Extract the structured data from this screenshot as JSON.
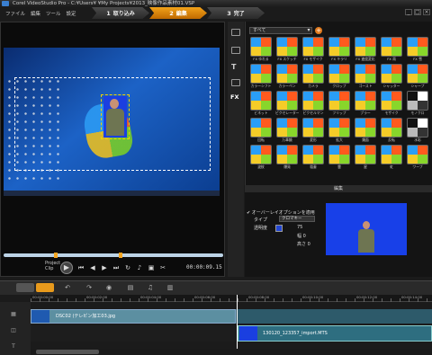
{
  "window": {
    "title": "Corel VideoStudio Pro - C:¥Users¥ ¥My Projects¥2013_映像作品素材01.VSP"
  },
  "menu": [
    "ファイル",
    "編集",
    "ツール",
    "設定"
  ],
  "steps": [
    {
      "num": "1",
      "label": "取り込み",
      "active": false
    },
    {
      "num": "2",
      "label": "編集",
      "active": true
    },
    {
      "num": "3",
      "label": "完了",
      "active": false
    }
  ],
  "window_buttons": [
    "_",
    "□",
    "×"
  ],
  "player": {
    "project_label": "Project",
    "clip_label": "Clip",
    "timecode": "00:00:09.15",
    "controls": [
      "play-icon",
      "home-icon",
      "prev-frame-icon",
      "next-frame-icon",
      "end-icon",
      "repeat-icon",
      "volume-icon"
    ]
  },
  "library": {
    "category": "すべて",
    "side_tab": "FX",
    "thumbs": [
      "FX ゆれる",
      "FX スケッチ",
      "FX モザイク",
      "FX キラリ",
      "FX 速度変化",
      "FX 雨",
      "FX 雪",
      "カラーシフト",
      "カラーペン",
      "カメラ",
      "クロップ",
      "ゴースト",
      "シャッター",
      "シャープ",
      "ビネット",
      "ピクセレーター",
      "ピクセルマン",
      "フリップ",
      "ブラー",
      "モザイク",
      "モノクロ",
      "回転",
      "万華鏡",
      "変形",
      "拡大",
      "鏡面",
      "反転",
      "水彩",
      "波紋",
      "爆発",
      "稲妻",
      "雲",
      "星",
      "虹",
      "ワープ"
    ]
  },
  "edit_panel": {
    "header": "編集",
    "overlay_option": "オーバーレイオプションを適用",
    "type_label": "タイプ",
    "type_value": "クロマキー",
    "transparency_label": "透明度",
    "numbers": [
      "75",
      "0",
      "0"
    ],
    "width_label": "幅",
    "height_label": "高さ"
  },
  "timeline": {
    "ruler": [
      "00:00:00:00",
      "00:00:02:00",
      "00:00:04:00",
      "00:00:06:00",
      "00:00:08:00",
      "00:00:10:00",
      "00:00:12:00",
      "00:00:14:00"
    ],
    "clip1": "DSC02 (テレビン加工03.jpg",
    "clip2": "130120_123357_import.MTS"
  }
}
